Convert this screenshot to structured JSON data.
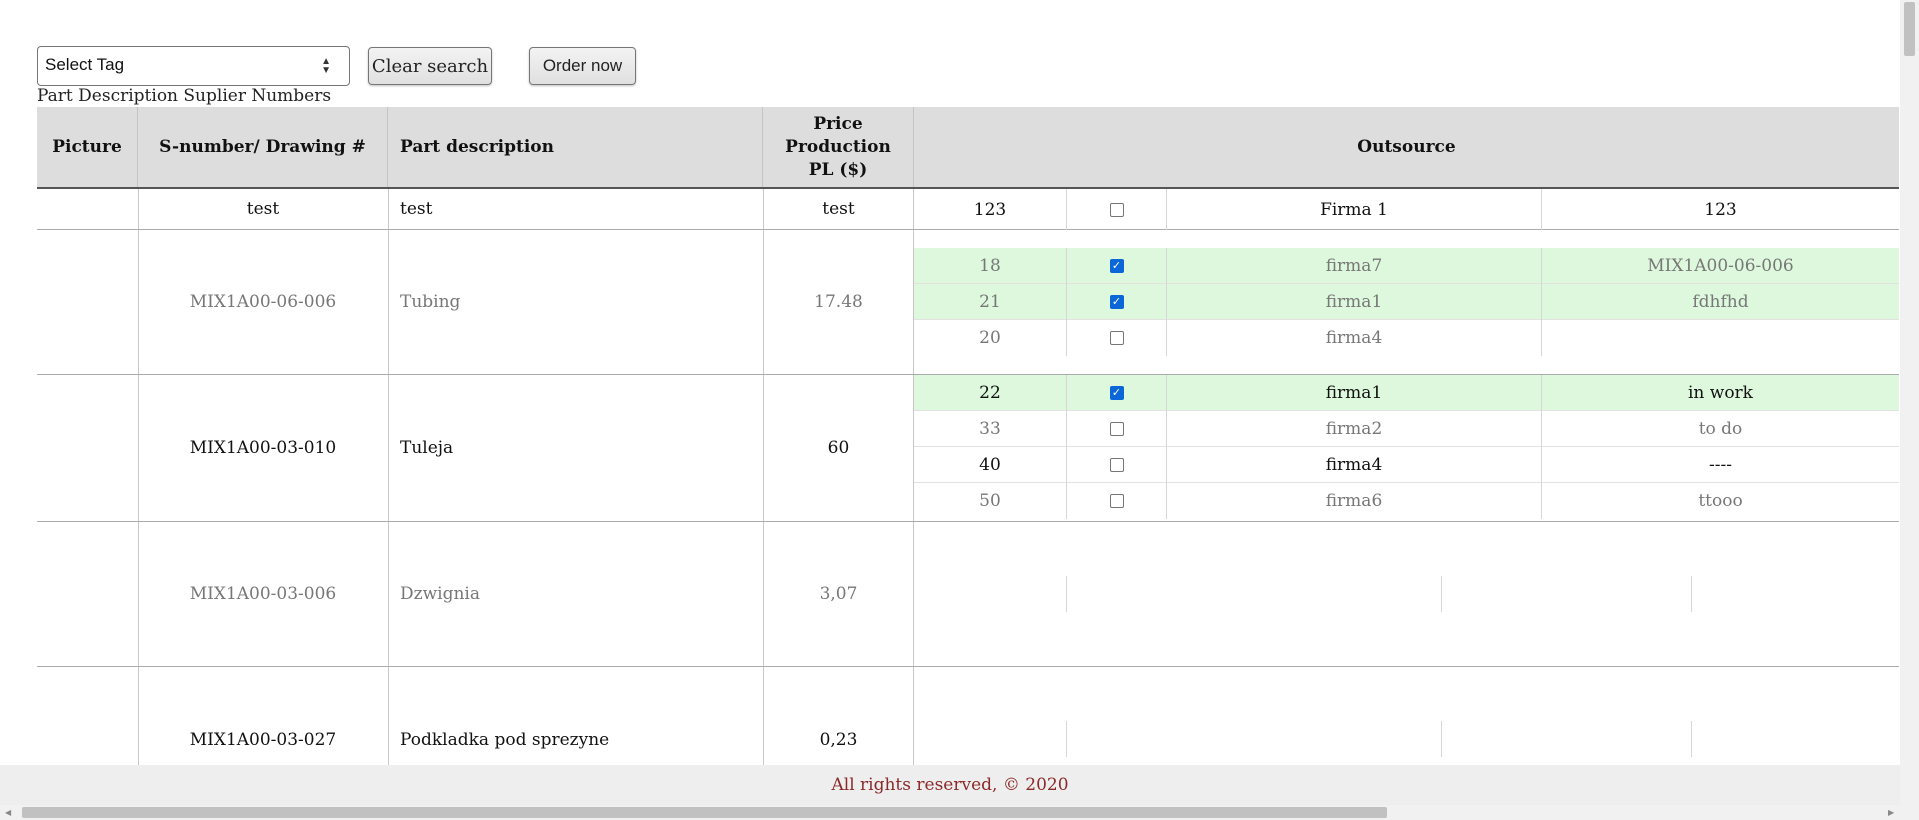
{
  "toolbar": {
    "select_tag": "Select Tag",
    "clear_search": "Clear search",
    "order_now": "Order now"
  },
  "subtitle": "Part Description Suplier Numbers",
  "columns": {
    "picture": "Picture",
    "s_number": "S-number/ Drawing #",
    "part_description": "Part description",
    "price": "Price Production PL ($)",
    "outsource": "Outsource"
  },
  "filter_row": {
    "s_number": "test",
    "part_description": "test",
    "price": "test",
    "outsource_qty": "123",
    "outsource_checked": false,
    "outsource_firm": "Firma 1",
    "outsource_note": "123"
  },
  "rows": [
    {
      "s_number": "MIX1A00-06-006",
      "part_description": "Tubing",
      "price": "17.48",
      "outsource": [
        {
          "qty": "18",
          "checked": true,
          "firm": "firma7",
          "note": "MIX1A00-06-006"
        },
        {
          "qty": "21",
          "checked": true,
          "firm": "firma1",
          "note": "fdhfhd"
        },
        {
          "qty": "20",
          "checked": false,
          "firm": "firma4",
          "note": ""
        }
      ]
    },
    {
      "s_number": "MIX1A00-03-010",
      "part_description": "Tuleja",
      "price": "60",
      "outsource": [
        {
          "qty": "22",
          "checked": true,
          "firm": "firma1",
          "note": "in work"
        },
        {
          "qty": "33",
          "checked": false,
          "firm": "firma2",
          "note": "to do"
        },
        {
          "qty": "40",
          "checked": false,
          "firm": "firma4",
          "note": "----"
        },
        {
          "qty": "50",
          "checked": false,
          "firm": "firma6",
          "note": "ttooo"
        }
      ]
    },
    {
      "s_number": "MIX1A00-03-006",
      "part_description": "Dzwignia",
      "price": "3,07",
      "outsource": []
    },
    {
      "s_number": "MIX1A00-03-027",
      "part_description": "Podkladka pod sprezyne",
      "price": "0,23",
      "outsource": []
    }
  ],
  "footer": "All rights reserved, © 2020",
  "colors": {
    "header_bg": "#dddddd",
    "selected_row_bg": "#ddf8dd",
    "checkbox_blue": "#0b66d8",
    "footer_text": "#8b2a2a"
  }
}
